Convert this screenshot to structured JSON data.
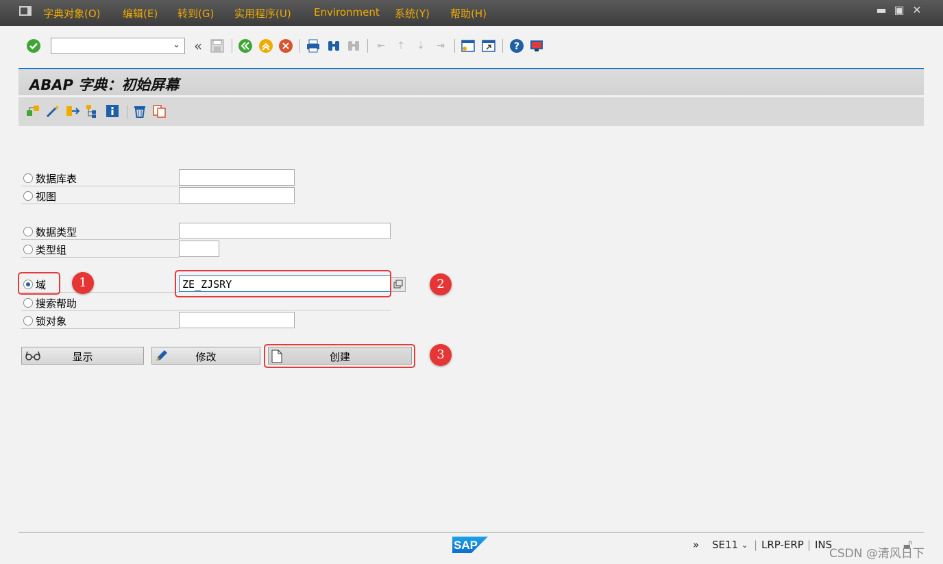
{
  "menubar": {
    "items": [
      "字典对象(O)",
      "编辑(E)",
      "转到(G)",
      "实用程序(U)",
      "Environment",
      "系统(Y)",
      "帮助(H)"
    ]
  },
  "toolbar": {
    "command_field_value": "",
    "icons": [
      "enter-icon",
      "command-field",
      "back-icon",
      "save-icon",
      "exit-icon",
      "cancel-icon",
      "print-icon",
      "find-icon",
      "find-next-icon",
      "first-page-icon",
      "previous-page-icon",
      "next-page-icon",
      "last-page-icon",
      "create-session-icon",
      "shortcut-icon",
      "help-icon",
      "layout-menu-icon"
    ]
  },
  "title": "ABAP 字典：初始屏幕",
  "app_toolbar": {
    "icons": [
      "other-object-icon",
      "create-wizard-icon",
      "where-used-icon",
      "hierarchy-icon",
      "info-icon",
      "delete-icon",
      "copy-icon"
    ]
  },
  "form": {
    "options": [
      {
        "label": "数据库表",
        "selected": false,
        "value": ""
      },
      {
        "label": "视图",
        "selected": false,
        "value": ""
      },
      {
        "label": "数据类型",
        "selected": false,
        "value": ""
      },
      {
        "label": "类型组",
        "selected": false,
        "value": ""
      },
      {
        "label": "域",
        "selected": true,
        "value": "ZE_ZJSRY"
      },
      {
        "label": "搜索帮助",
        "selected": false,
        "value": ""
      },
      {
        "label": "锁对象",
        "selected": false,
        "value": ""
      }
    ]
  },
  "buttons": {
    "display": "显示",
    "change": "修改",
    "create": "创建"
  },
  "annotations": {
    "badge1": "1",
    "badge2": "2",
    "badge3": "3",
    "color": "#e23b3b"
  },
  "status": {
    "chevron": "»",
    "transaction": "SE11",
    "system": "LRP-ERP",
    "mode": "INS"
  },
  "watermark": "CSDN @清风日下",
  "colors": {
    "menu_text": "#f0ab00",
    "title_accent": "#1879c8",
    "sap_blue": "#0a6ed1"
  }
}
